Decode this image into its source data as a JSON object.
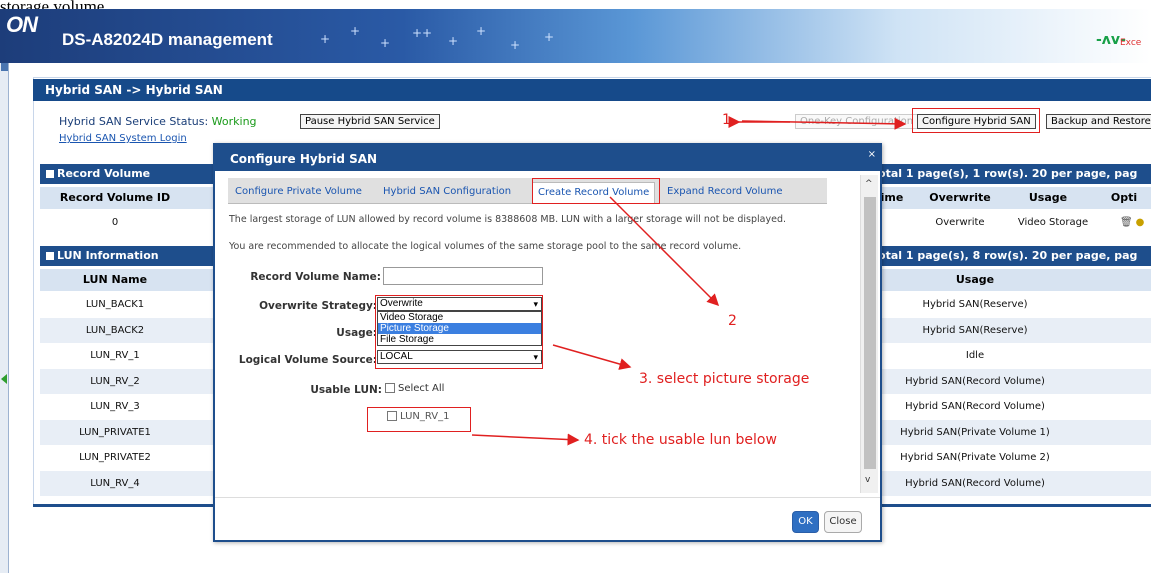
{
  "top_clip_text": "storage volume.",
  "app": {
    "brand": "ON",
    "product_title": "DS-A82024D management",
    "heartbeat_label": "Exce"
  },
  "page": {
    "title": "Hybrid SAN -> Hybrid SAN",
    "status_label": "Hybrid SAN Service Status: ",
    "status_value": "Working",
    "pause_button": "Pause Hybrid SAN Service",
    "system_login_link": "Hybrid SAN System Login",
    "one_key_button": "One-Key Configuration",
    "configure_button": "Configure Hybrid SAN",
    "backup_button": "Backup and Restore"
  },
  "record_volume": {
    "title": "Record Volume",
    "pager": "Total 1 page(s), 1 row(s). 20 per page, pag",
    "headers": {
      "id": "Record Volume ID",
      "time": "ime",
      "overwrite": "Overwrite",
      "usage": "Usage",
      "options": "Opti"
    },
    "rows": [
      {
        "id": "0",
        "overwrite": "Overwrite",
        "usage": "Video Storage"
      }
    ]
  },
  "lun_info": {
    "title": "LUN Information",
    "pager": "Total 1 page(s), 8 row(s). 20 per page, pag",
    "headers": {
      "name": "LUN Name",
      "usage": "Usage"
    },
    "rows": [
      {
        "name": "LUN_BACK1",
        "usage": "Hybrid SAN(Reserve)"
      },
      {
        "name": "LUN_BACK2",
        "usage": "Hybrid SAN(Reserve)"
      },
      {
        "name": "LUN_RV_1",
        "usage": "Idle"
      },
      {
        "name": "LUN_RV_2",
        "usage": "Hybrid SAN(Record Volume)"
      },
      {
        "name": "LUN_RV_3",
        "usage": "Hybrid SAN(Record Volume)"
      },
      {
        "name": "LUN_PRIVATE1",
        "usage": "Hybrid SAN(Private Volume 1)"
      },
      {
        "name": "LUN_PRIVATE2",
        "usage": "Hybrid SAN(Private Volume 2)"
      },
      {
        "name": "LUN_RV_4",
        "usage": "Hybrid SAN(Record Volume)"
      }
    ]
  },
  "dialog": {
    "title": "Configure Hybrid SAN",
    "close_glyph": "×",
    "tabs": [
      "Configure Private Volume",
      "Hybrid SAN Configuration",
      "Create Record Volume",
      "Expand Record Volume"
    ],
    "info_line1": "The largest storage of LUN allowed by record volume is 8388608 MB. LUN with a larger storage will not be displayed.",
    "info_line2": "You are recommended to allocate the logical volumes of the same storage pool to the same record volume.",
    "name_label": "Record Volume Name:",
    "name_value": "",
    "overwrite_label": "Overwrite Strategy:",
    "overwrite_value": "Overwrite",
    "usage_label": "Usage:",
    "usage_options": [
      "Video Storage",
      "Picture Storage",
      "File Storage"
    ],
    "usage_highlighted": "Picture Storage",
    "source_label": "Logical Volume Source:",
    "source_value": "LOCAL",
    "usable_label": "Usable LUN:",
    "select_all": "Select All",
    "lun_option": "LUN_RV_1",
    "ok": "OK",
    "close": "Close"
  },
  "annotations": {
    "step1": "1",
    "step2": "2",
    "step3": "3. select picture storage",
    "step4": "4. tick the usable lun below"
  },
  "colors": {
    "header_blue": "#1e4e8c",
    "annotation_red": "#e02020",
    "status_green": "#1a9a1a",
    "highlight": "#3b7fe0"
  }
}
